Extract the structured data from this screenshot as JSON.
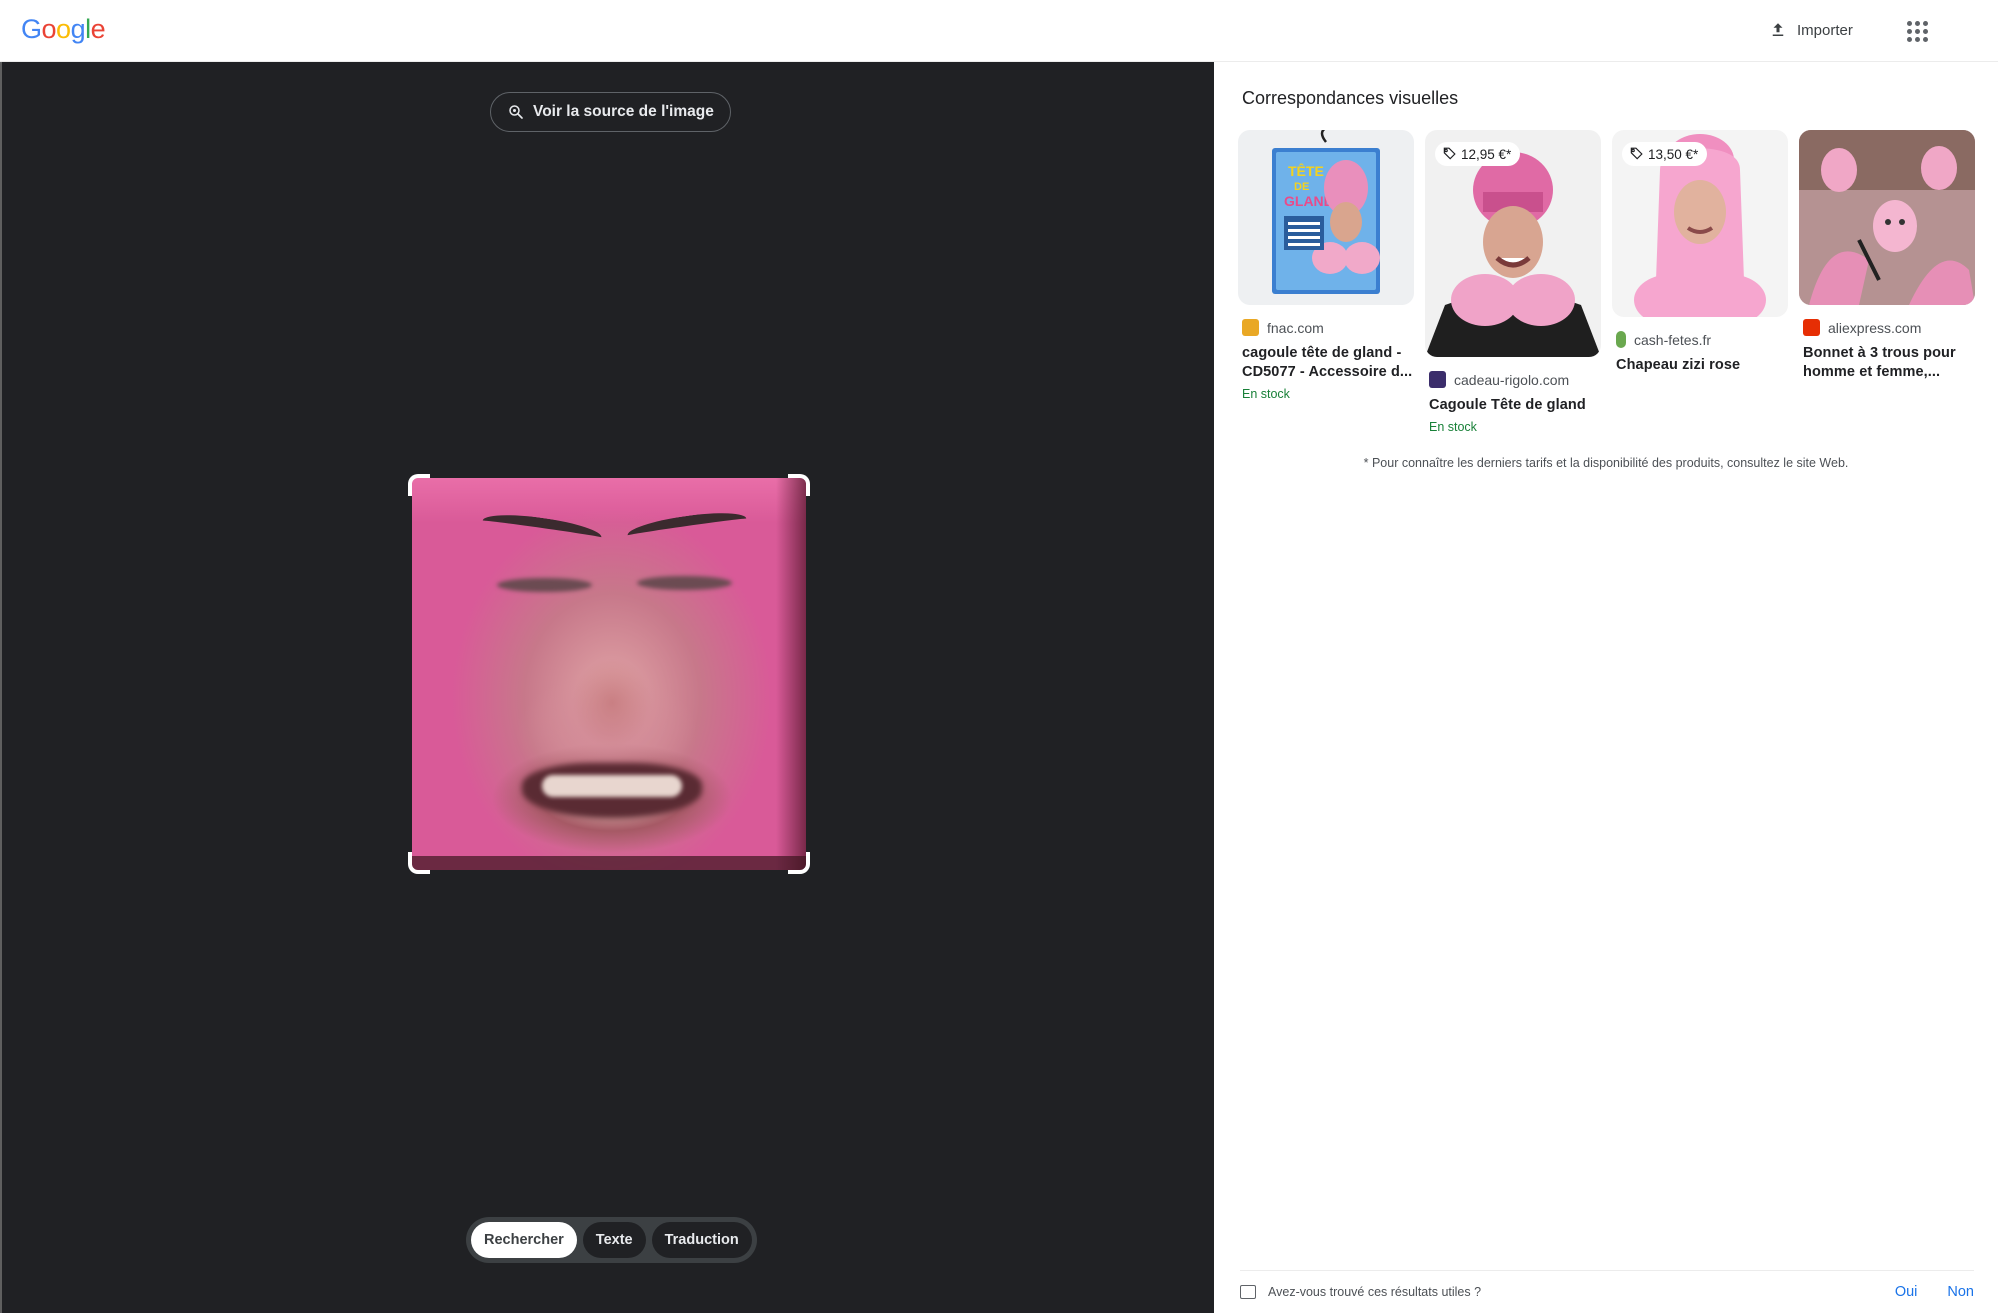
{
  "header": {
    "logo_text": "Google",
    "logo_letters": [
      {
        "char": "G",
        "color": "#4285F4"
      },
      {
        "char": "o",
        "color": "#EA4335"
      },
      {
        "char": "o",
        "color": "#FBBC05"
      },
      {
        "char": "g",
        "color": "#4285F4"
      },
      {
        "char": "l",
        "color": "#34A853"
      },
      {
        "char": "e",
        "color": "#EA4335"
      }
    ],
    "import_label": "Importer",
    "import_icon": "upload-icon",
    "apps_icon": "apps-grid-icon"
  },
  "viewer": {
    "source_button_label": "Voir la source de l'image",
    "source_icon": "lens-search-icon",
    "selected_image": "close-up of a grimacing face wearing a pink hat, with crop corner handles",
    "modes": [
      {
        "label": "Rechercher",
        "active": true
      },
      {
        "label": "Texte",
        "active": false
      },
      {
        "label": "Traduction",
        "active": false
      }
    ]
  },
  "results": {
    "section_title": "Correspondances visuelles",
    "cards": [
      {
        "image": "packaged pink novelty hat costume, blue packaging",
        "price": "",
        "site": "fnac.com",
        "site_color": "#e9a825",
        "title": "cagoule tête de gland - CD5077 - Accessoire d...",
        "stock": "En stock"
      },
      {
        "image": "person wearing a pink novelty hat costume",
        "price": "12,95 €*",
        "site": "cadeau-rigolo.com",
        "site_color": "#3b2d6b",
        "title": "Cagoule Tête de gland",
        "stock": "En stock"
      },
      {
        "image": "person wearing a pink novelty hat",
        "price": "13,50 €*",
        "site": "cash-fetes.fr",
        "site_color": "#6aa84f",
        "title": "Chapeau zizi rose",
        "stock": ""
      },
      {
        "image": "group of people wearing pink knitted three-hole balaclavas",
        "price": "",
        "site": "aliexpress.com",
        "site_color": "#e62e04",
        "title": "Bonnet à 3 trous pour homme et femme,...",
        "stock": ""
      }
    ],
    "disclaimer": "* Pour connaître les derniers tarifs et la disponibilité des produits, consultez le site Web."
  },
  "feedback": {
    "question": "Avez-vous trouvé ces résultats utiles ?",
    "yes": "Oui",
    "no": "Non",
    "icon": "feedback-icon"
  },
  "colors": {
    "viewer_bg": "#202124",
    "link_blue": "#1a73e8",
    "stock_green": "#188038"
  }
}
